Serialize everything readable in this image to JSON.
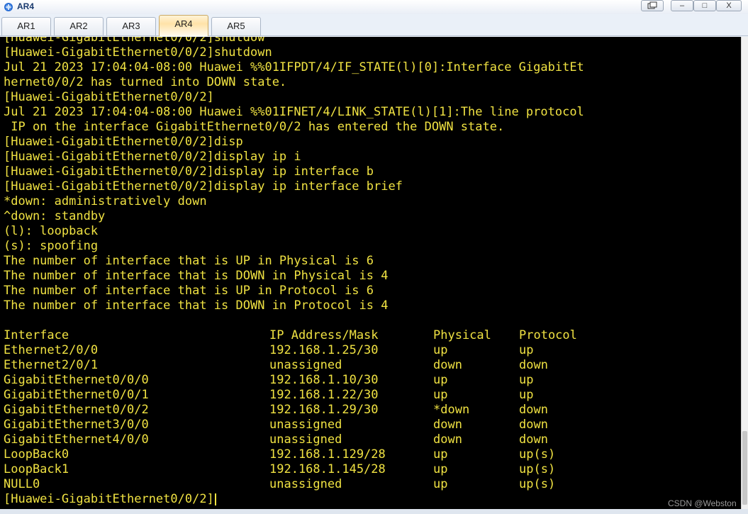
{
  "window": {
    "title": "AR4",
    "restore_label": "",
    "minimize_label": "–",
    "maximize_label": "□",
    "close_label": "X"
  },
  "tabs": [
    {
      "label": "AR1",
      "active": false
    },
    {
      "label": "AR2",
      "active": false
    },
    {
      "label": "AR3",
      "active": false
    },
    {
      "label": "AR4",
      "active": true
    },
    {
      "label": "AR5",
      "active": false
    }
  ],
  "terminal": {
    "colors": {
      "text": "#f0e242",
      "background": "#000000"
    },
    "lines": [
      "[Huawei-GigabitEthernet0/0/2]shutdow",
      "[Huawei-GigabitEthernet0/0/2]shutdown",
      "Jul 21 2023 17:04:04-08:00 Huawei %%01IFPDT/4/IF_STATE(l)[0]:Interface GigabitEt",
      "hernet0/0/2 has turned into DOWN state.",
      "[Huawei-GigabitEthernet0/0/2]",
      "Jul 21 2023 17:04:04-08:00 Huawei %%01IFNET/4/LINK_STATE(l)[1]:The line protocol",
      " IP on the interface GigabitEthernet0/0/2 has entered the DOWN state.",
      "[Huawei-GigabitEthernet0/0/2]disp",
      "[Huawei-GigabitEthernet0/0/2]display ip i",
      "[Huawei-GigabitEthernet0/0/2]display ip interface b",
      "[Huawei-GigabitEthernet0/0/2]display ip interface brief",
      "*down: administratively down",
      "^down: standby",
      "(l): loopback",
      "(s): spoofing",
      "The number of interface that is UP in Physical is 6",
      "The number of interface that is DOWN in Physical is 4",
      "The number of interface that is UP in Protocol is 6",
      "The number of interface that is DOWN in Protocol is 4",
      ""
    ],
    "table": {
      "headers": [
        "Interface",
        "IP Address/Mask",
        "Physical",
        "Protocol"
      ],
      "rows": [
        [
          "Ethernet2/0/0",
          "192.168.1.25/30",
          "up",
          "up"
        ],
        [
          "Ethernet2/0/1",
          "unassigned",
          "down",
          "down"
        ],
        [
          "GigabitEthernet0/0/0",
          "192.168.1.10/30",
          "up",
          "up"
        ],
        [
          "GigabitEthernet0/0/1",
          "192.168.1.22/30",
          "up",
          "up"
        ],
        [
          "GigabitEthernet0/0/2",
          "192.168.1.29/30",
          "*down",
          "down"
        ],
        [
          "GigabitEthernet3/0/0",
          "unassigned",
          "down",
          "down"
        ],
        [
          "GigabitEthernet4/0/0",
          "unassigned",
          "down",
          "down"
        ],
        [
          "LoopBack0",
          "192.168.1.129/28",
          "up",
          "up(s)"
        ],
        [
          "LoopBack1",
          "192.168.1.145/28",
          "up",
          "up(s)"
        ],
        [
          "NULL0",
          "unassigned",
          "up",
          "up(s)"
        ]
      ]
    },
    "prompt": "[Huawei-GigabitEthernet0/0/2]"
  },
  "watermark": "CSDN @Webston"
}
